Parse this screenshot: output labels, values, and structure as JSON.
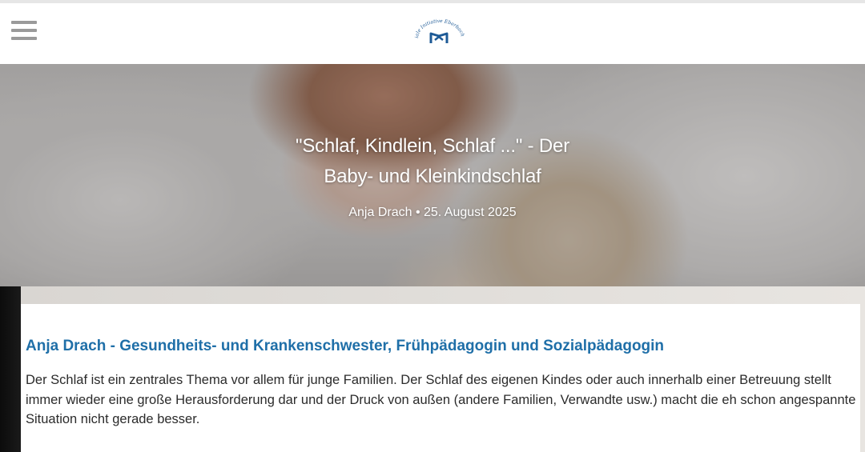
{
  "header": {
    "menu_icon": "hamburger-menu-icon",
    "logo_text": "Soziale Initiative Eberbach e.V."
  },
  "hero": {
    "title_line1": "\"Schlaf, Kindlein, Schlaf ...\" - Der",
    "title_line2": "Baby- und Kleinkindschlaf",
    "meta": "Anja Drach • 25. August 2025"
  },
  "article": {
    "heading": "Anja Drach - Gesundheits- und Krankenschwester, Frühpädagogin und Sozialpädagogin",
    "body": "Der Schlaf ist ein zentrales Thema vor allem für junge Familien. Der Schlaf des eigenen Kindes oder auch innerhalb einer Betreuung stellt immer wieder eine große Herausforderung dar und der Druck von außen (andere Familien, Verwandte usw.) macht die eh schon angespannte Situation nicht gerade besser."
  },
  "colors": {
    "heading": "#1f6fa8",
    "logo": "#1d5a96",
    "menu_icon": "#9a9a9a"
  }
}
